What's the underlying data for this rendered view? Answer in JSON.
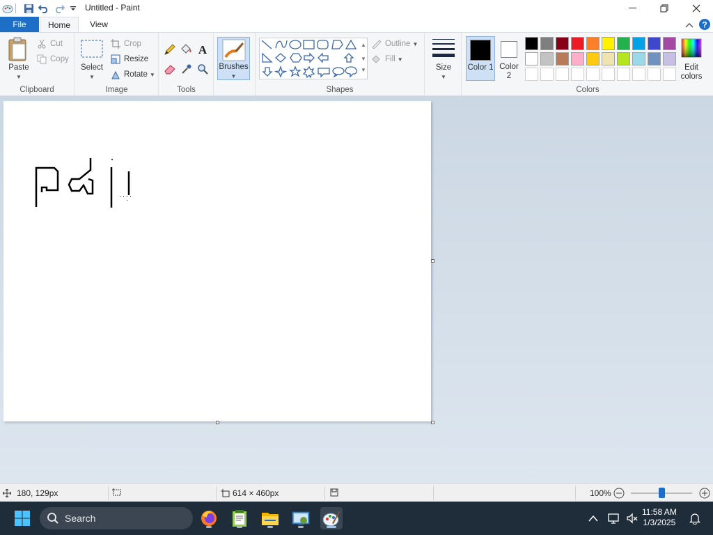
{
  "window": {
    "title": "Untitled - Paint",
    "minimize_glyph": "—",
    "maximize_glyph": "❐",
    "close_glyph": "✕"
  },
  "tabs": {
    "file": "File",
    "home": "Home",
    "view": "View"
  },
  "ribbon": {
    "clipboard": {
      "label": "Clipboard",
      "paste": "Paste",
      "cut": "Cut",
      "copy": "Copy"
    },
    "image": {
      "label": "Image",
      "select": "Select",
      "crop": "Crop",
      "resize": "Resize",
      "rotate": "Rotate"
    },
    "tools": {
      "label": "Tools"
    },
    "brushes": {
      "label": "Brushes"
    },
    "shapes": {
      "label": "Shapes",
      "outline": "Outline",
      "fill": "Fill"
    },
    "size": {
      "label": "Size"
    },
    "colors": {
      "label": "Colors",
      "color1": "Color 1",
      "color2": "Color 2",
      "edit_colors": "Edit colors",
      "color1_value": "#000000",
      "color2_value": "#ffffff",
      "palette_row1": [
        "#000000",
        "#7f7f7f",
        "#880015",
        "#ed1c24",
        "#ff7f27",
        "#fff200",
        "#22b14c",
        "#00a2e8",
        "#3f48cc",
        "#a349a4"
      ],
      "palette_row2": [
        "#ffffff",
        "#c3c3c3",
        "#b97a57",
        "#ffaec9",
        "#ffc90e",
        "#efe4b0",
        "#b5e61d",
        "#99d9ea",
        "#7092be",
        "#c8bfe7"
      ],
      "palette_row3": [
        "#ffffff",
        "#ffffff",
        "#ffffff",
        "#ffffff",
        "#ffffff",
        "#ffffff",
        "#ffffff",
        "#ffffff",
        "#ffffff",
        "#ffffff"
      ]
    }
  },
  "status": {
    "cursor_position": "180, 129px",
    "canvas_size": "614 × 460px",
    "zoom": "100%"
  },
  "taskbar": {
    "search_placeholder": "Search",
    "time": "11:58 AM",
    "date": "1/3/2025"
  }
}
